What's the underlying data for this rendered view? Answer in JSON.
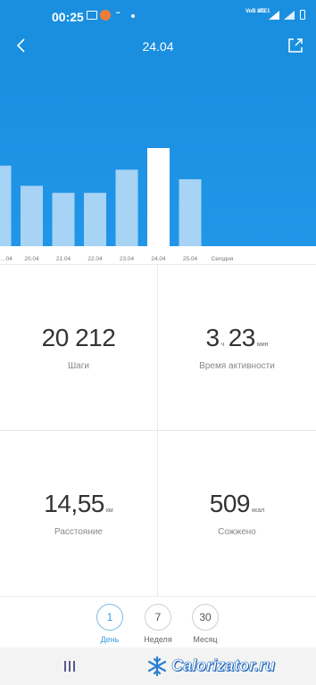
{
  "status_bar": {
    "time": "00:25",
    "network_label": "VoB LTE1",
    "net_type": "4G",
    "icons": [
      "image-icon",
      "app-notification-icon",
      "small-text-icon",
      "dot-icon",
      "signal-icon",
      "signal-icon",
      "battery-icon"
    ]
  },
  "header": {
    "title": "24.04",
    "back_icon": "chevron-left-icon",
    "share_icon": "share-icon",
    "color": "#1a8fe0"
  },
  "chart_data": {
    "type": "bar",
    "categories": [
      "…04",
      "20.04",
      "21.04",
      "22.04",
      "23.04",
      "24.04",
      "25.04",
      "Сегодня"
    ],
    "values": [
      16000,
      12000,
      10600,
      10600,
      15200,
      19500,
      13300,
      0
    ],
    "selected": "24.04",
    "bar_color": "#a7d3f5",
    "selected_bar_color": "#ffffff",
    "background": "#1a8fe0"
  },
  "stats": {
    "steps": {
      "value": "20 212",
      "label": "Шаги"
    },
    "active_time": {
      "hours": "3",
      "hours_unit": "ч",
      "minutes": "23",
      "minutes_unit": "мин",
      "label": "Время активности"
    },
    "distance": {
      "value": "14,55",
      "unit": "км",
      "label": "Расстояние"
    },
    "calories": {
      "value": "509",
      "unit": "ккал",
      "label": "Сожжено"
    }
  },
  "tabs": [
    {
      "number": "1",
      "label": "День",
      "active": true
    },
    {
      "number": "7",
      "label": "Неделя",
      "active": false
    },
    {
      "number": "30",
      "label": "Месяц",
      "active": false
    }
  ],
  "watermark": {
    "text": "Calorizator.ru",
    "icon": "snowflake-icon"
  }
}
